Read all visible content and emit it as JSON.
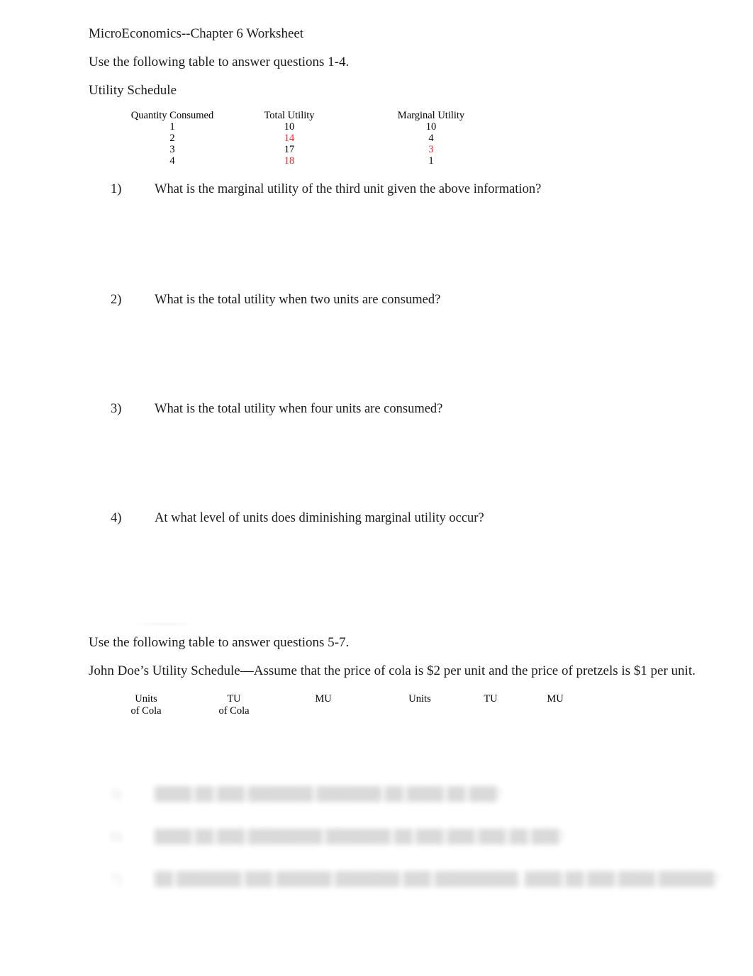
{
  "document": {
    "title": "MicroEconomics--Chapter 6 Worksheet",
    "instruction_1_4": "Use the following table to answer questions 1-4.",
    "schedule_heading": "Utility Schedule",
    "instruction_5_7": "Use the following table to answer questions 5-7.",
    "johndoe_heading": "John Doe’s Utility Schedule—Assume that the price of cola is $2 per unit and the price of pretzels is $1 per unit."
  },
  "colors": {
    "text": "#1a1a1a",
    "highlight_red": "#ff2020",
    "page_background": "#ffffff"
  },
  "utility_schedule": {
    "headers": [
      "Quantity Consumed",
      "Total Utility",
      "Marginal Utility"
    ],
    "rows": [
      {
        "quantity": "1",
        "total_utility": "10",
        "marginal_utility": "10",
        "tu_red": false,
        "mu_red": false
      },
      {
        "quantity": "2",
        "total_utility": "14",
        "marginal_utility": "4",
        "tu_red": true,
        "mu_red": false
      },
      {
        "quantity": "3",
        "total_utility": "17",
        "marginal_utility": "3",
        "tu_red": false,
        "mu_red": true
      },
      {
        "quantity": "4",
        "total_utility": "18",
        "marginal_utility": "1",
        "tu_red": true,
        "mu_red": false
      }
    ]
  },
  "questions": [
    {
      "number": "1)",
      "text": "What is the marginal utility of the third unit given the above information?"
    },
    {
      "number": "2)",
      "text": "What is the total utility when two units are consumed?"
    },
    {
      "number": "3)",
      "text": "What is the total utility when four units are consumed?"
    },
    {
      "number": "4)",
      "text": "At what level of units does diminishing marginal utility occur?"
    }
  ],
  "johndoe_schedule": {
    "headers_line1": [
      "Units",
      "TU",
      "MU",
      "Units",
      "TU",
      "MU"
    ],
    "headers_line2": [
      "of Cola",
      "of Cola",
      "",
      "",
      "",
      ""
    ],
    "rows": [
      {
        "c0": "",
        "c1": "",
        "c2": "",
        "c3": "",
        "c4": "",
        "c5": ""
      },
      {
        "c0": "",
        "c1": "",
        "c2": "",
        "c3": "",
        "c4": "",
        "c5": ""
      },
      {
        "c0": "",
        "c1": "",
        "c2": "",
        "c3": "",
        "c4": "",
        "c5": ""
      },
      {
        "c0": "",
        "c1": "",
        "c2": "",
        "c3": "",
        "c4": "",
        "c5": ""
      }
    ]
  },
  "questions_faded": [
    {
      "number": "5)",
      "text": "████ ██ ███ ███████ ███████ ██ ████ ██ ███?"
    },
    {
      "number": "6)",
      "text": "████ ██ ███ ████████ ███████ ██ ███ ███ ███ ██ ███?"
    },
    {
      "number": "7)",
      "text": "██ ███████ ███ ██████ ███████ ███ █████████, ████ ██ ███ ████ ██████?"
    }
  ]
}
